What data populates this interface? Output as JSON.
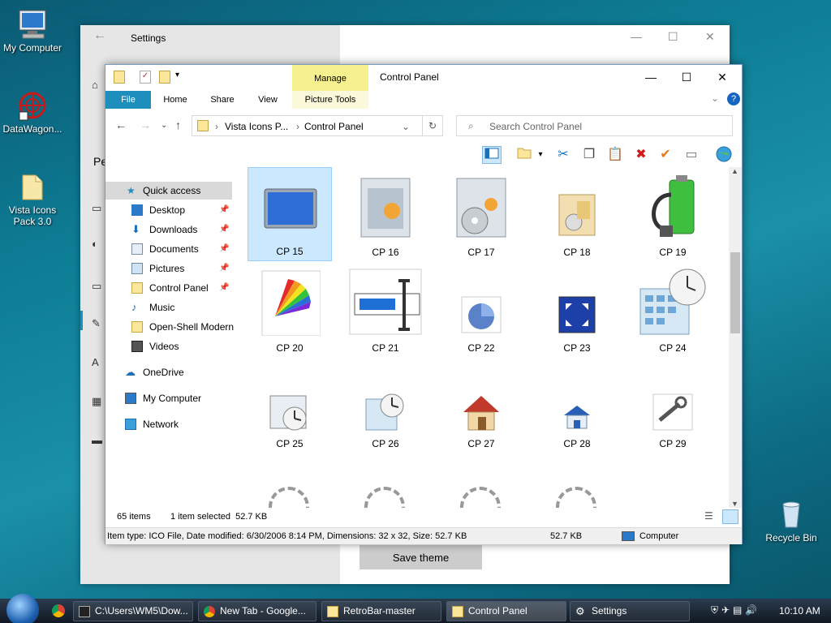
{
  "desktop": {
    "icons": [
      {
        "label": "My Computer"
      },
      {
        "label": "DataWagon..."
      },
      {
        "label": "Vista Icons Pack 3.0"
      },
      {
        "label": "Recycle Bin"
      }
    ]
  },
  "settings": {
    "title": "Settings",
    "side_heading": "Pe",
    "save_button": "Save theme"
  },
  "explorer": {
    "title": "Control Panel",
    "ribbon": {
      "manage": "Manage",
      "tabs": [
        "File",
        "Home",
        "Share",
        "View",
        "Picture Tools"
      ]
    },
    "address": {
      "crumb1": "Vista Icons P...",
      "crumb2": "Control Panel"
    },
    "search_placeholder": "Search Control Panel",
    "nav": [
      {
        "label": "Quick access"
      },
      {
        "label": "Desktop"
      },
      {
        "label": "Downloads"
      },
      {
        "label": "Documents"
      },
      {
        "label": "Pictures"
      },
      {
        "label": "Control Panel"
      },
      {
        "label": "Music"
      },
      {
        "label": "Open-Shell Modern"
      },
      {
        "label": "Videos"
      },
      {
        "label": "OneDrive"
      },
      {
        "label": "My Computer"
      },
      {
        "label": "Network"
      }
    ],
    "items": [
      "CP 15",
      "CP 16",
      "CP 17",
      "CP 18",
      "CP 19",
      "CP 20",
      "CP 21",
      "CP 22",
      "CP 23",
      "CP 24",
      "CP 25",
      "CP 26",
      "CP 27",
      "CP 28",
      "CP 29"
    ],
    "status": {
      "count": "65 items",
      "selected": "1 item selected  52.7 KB"
    },
    "detail": {
      "info": "Item type: ICO File, Date modified: 6/30/2006 8:14 PM, Dimensions: 32 x 32, Size: 52.7 KB",
      "size": "52.7 KB",
      "location": "Computer"
    }
  },
  "taskbar": {
    "buttons": [
      {
        "label": "C:\\Users\\WM5\\Dow..."
      },
      {
        "label": "New Tab - Google..."
      },
      {
        "label": "RetroBar-master"
      },
      {
        "label": "Control Panel"
      },
      {
        "label": "Settings"
      }
    ],
    "clock": "10:10 AM"
  },
  "colors": {
    "accent": "#1e8fbd",
    "manage": "#f6f08f",
    "selection": "#cce8ff"
  }
}
